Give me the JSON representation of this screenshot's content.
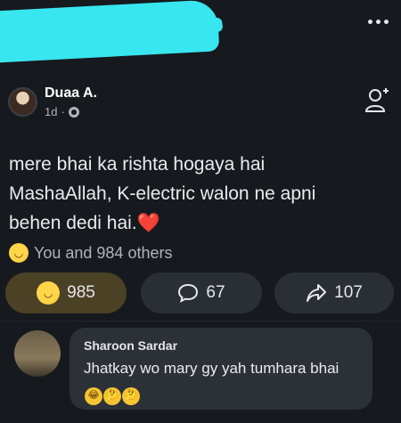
{
  "post": {
    "author": "Duaa A.",
    "time": "1d",
    "separator": "·",
    "text_line1": "mere bhai ka rishta hogaya hai",
    "text_line2": "MashaAllah, K-electric walon ne apni",
    "text_line3": "behen dedi hai.",
    "heart": "❤️"
  },
  "reactions": {
    "summary": "You and 984 others",
    "icon": "laugh-emoji"
  },
  "actions": {
    "react_count": "985",
    "comment_count": "67",
    "share_count": "107"
  },
  "comment": {
    "author": "Sharoon Sardar",
    "text": "Jhatkay wo mary gy yah tumhara bhai",
    "emojis": [
      "😂",
      "🤔",
      "🤔"
    ]
  },
  "colors": {
    "background": "#161a1f",
    "react_active": "#4b4124",
    "pill": "#2a2f36",
    "comment_bubble": "#2c3138"
  }
}
